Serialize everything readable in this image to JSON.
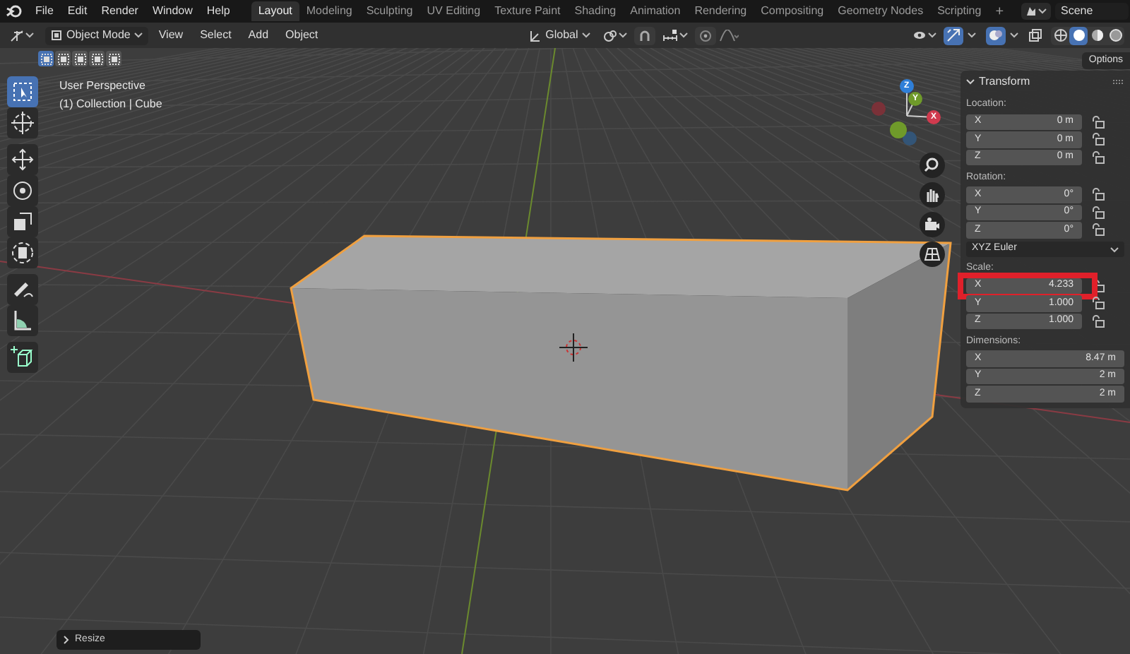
{
  "menus": [
    "File",
    "Edit",
    "Render",
    "Window",
    "Help"
  ],
  "workspace_tabs": [
    {
      "label": "Layout",
      "selected": true
    },
    {
      "label": "Modeling",
      "selected": false
    },
    {
      "label": "Sculpting",
      "selected": false
    },
    {
      "label": "UV Editing",
      "selected": false
    },
    {
      "label": "Texture Paint",
      "selected": false
    },
    {
      "label": "Shading",
      "selected": false
    },
    {
      "label": "Animation",
      "selected": false
    },
    {
      "label": "Rendering",
      "selected": false
    },
    {
      "label": "Compositing",
      "selected": false
    },
    {
      "label": "Geometry Nodes",
      "selected": false
    },
    {
      "label": "Scripting",
      "selected": false
    }
  ],
  "add_workspace": "+",
  "scene": "Scene",
  "header": {
    "mode": "Object Mode",
    "menus": [
      "View",
      "Select",
      "Add",
      "Object"
    ],
    "orientation": "Global",
    "snap_on": false,
    "proportional_on": false,
    "gizmo_on": true,
    "overlays_on": true,
    "shading_modes": [
      {
        "selected": false
      },
      {
        "selected": true
      },
      {
        "selected": false
      },
      {
        "selected": false
      }
    ]
  },
  "select_modes": [
    {
      "selected": true
    },
    {
      "selected": false
    },
    {
      "selected": false
    },
    {
      "selected": false
    },
    {
      "selected": false
    }
  ],
  "options": "Options",
  "viewport": {
    "title": "User Perspective",
    "subtitle": "(1) Collection | Cube"
  },
  "tools": [
    {
      "kind": "select",
      "selected": true
    },
    {
      "kind": "cursor",
      "selected": false
    },
    {
      "kind": "move",
      "selected": false
    },
    {
      "kind": "rotate",
      "selected": false
    },
    {
      "kind": "scale",
      "selected": false
    },
    {
      "kind": "transform",
      "selected": false
    },
    {
      "kind": "annotate",
      "selected": false
    },
    {
      "kind": "measure",
      "selected": false
    },
    {
      "kind": "addcube",
      "selected": false
    }
  ],
  "gizmo": {
    "z": "Z",
    "y": "Y",
    "x": "X"
  },
  "transform": {
    "title": "Transform",
    "sections": [
      {
        "label": "Location:",
        "rows": [
          {
            "axis": "X",
            "value": "0 m",
            "locked": false
          },
          {
            "axis": "Y",
            "value": "0 m",
            "locked": false
          },
          {
            "axis": "Z",
            "value": "0 m",
            "locked": false
          }
        ]
      },
      {
        "label": "Rotation:",
        "rows": [
          {
            "axis": "X",
            "value": "0°",
            "locked": false
          },
          {
            "axis": "Y",
            "value": "0°",
            "locked": false
          },
          {
            "axis": "Z",
            "value": "0°",
            "locked": false
          }
        ],
        "mode": "XYZ Euler"
      },
      {
        "label": "Scale:",
        "rows": [
          {
            "axis": "X",
            "value": "4.233",
            "locked": false
          },
          {
            "axis": "Y",
            "value": "1.000",
            "locked": false
          },
          {
            "axis": "Z",
            "value": "1.000",
            "locked": false
          }
        ]
      },
      {
        "label": "Dimensions:",
        "rows": [
          {
            "axis": "X",
            "value": "8.47 m"
          },
          {
            "axis": "Y",
            "value": "2 m"
          },
          {
            "axis": "Z",
            "value": "2 m"
          }
        ]
      }
    ]
  },
  "last_operator": "Resize"
}
